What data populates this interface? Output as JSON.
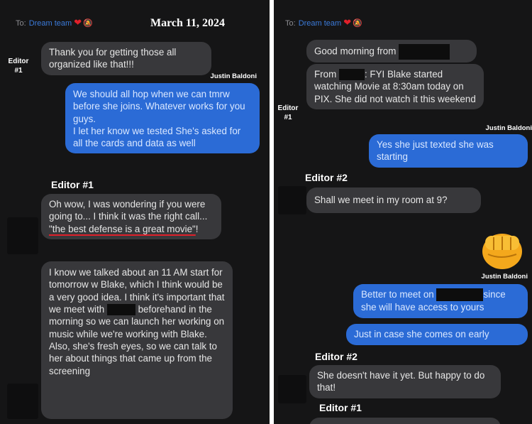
{
  "left": {
    "to_prefix": "To:",
    "to_name": "Dream team",
    "date": "March 11, 2024",
    "sender_editor1_small": "Editor #1",
    "msg1": "Thank you for getting those all organized like that!!!",
    "sender_justin": "Justin Baldoni",
    "msg2_line1": "We should all hop when we can tmrw before she joins. Whatever works for you guys.",
    "msg2_line2": "I let her know we tested She's asked for all the cards and data as well",
    "sender_editor1": "Editor #1",
    "msg3_part1": "Oh wow, I was wondering if you were going to... I think it was the right call... ",
    "msg3_part2": "\"the best defense is a great movie\"",
    "msg3_part3": "!",
    "msg4_part1": "I know we talked about an 11 AM start for tomorrow w Blake, which I think would be a very good idea. I think it's important that we meet with",
    "msg4_part2": "beforehand in the morning so we can launch her working on music while we're working with Blake. Also, she's fresh eyes, so we can talk to her about things that came up from the screening"
  },
  "right": {
    "to_prefix": "To:",
    "to_name": "Dream team",
    "msg1": "Good morning from",
    "msg2_part1": "From",
    "msg2_part2": ": FYI Blake started watching Movie at 8:30am today on PIX.  She did not watch it this weekend",
    "sender_editor1_small": "Editor #1",
    "sender_justin": "Justin Baldoni",
    "msg3": "Yes she just texted she was starting",
    "sender_editor2": "Editor #2",
    "msg4": "Shall we meet in my room at 9?",
    "sender_justin_2": "Justin Baldoni",
    "msg5_part1": "Better to meet on",
    "msg5_part2": "since she will have access to yours",
    "msg6": "Just in case she comes on early",
    "sender_editor2_b": "Editor #2",
    "msg7": "She doesn't have it yet. But happy to do that!",
    "sender_editor1": "Editor #1"
  },
  "icons": {
    "heart": "heart-icon",
    "bell": "muted-bell-icon",
    "fist": "fist-bump-emoji"
  },
  "colors": {
    "background": "#151516",
    "gray_bubble": "#38383b",
    "blue_bubble": "#2b6bd6",
    "underline": "#e0202a"
  }
}
